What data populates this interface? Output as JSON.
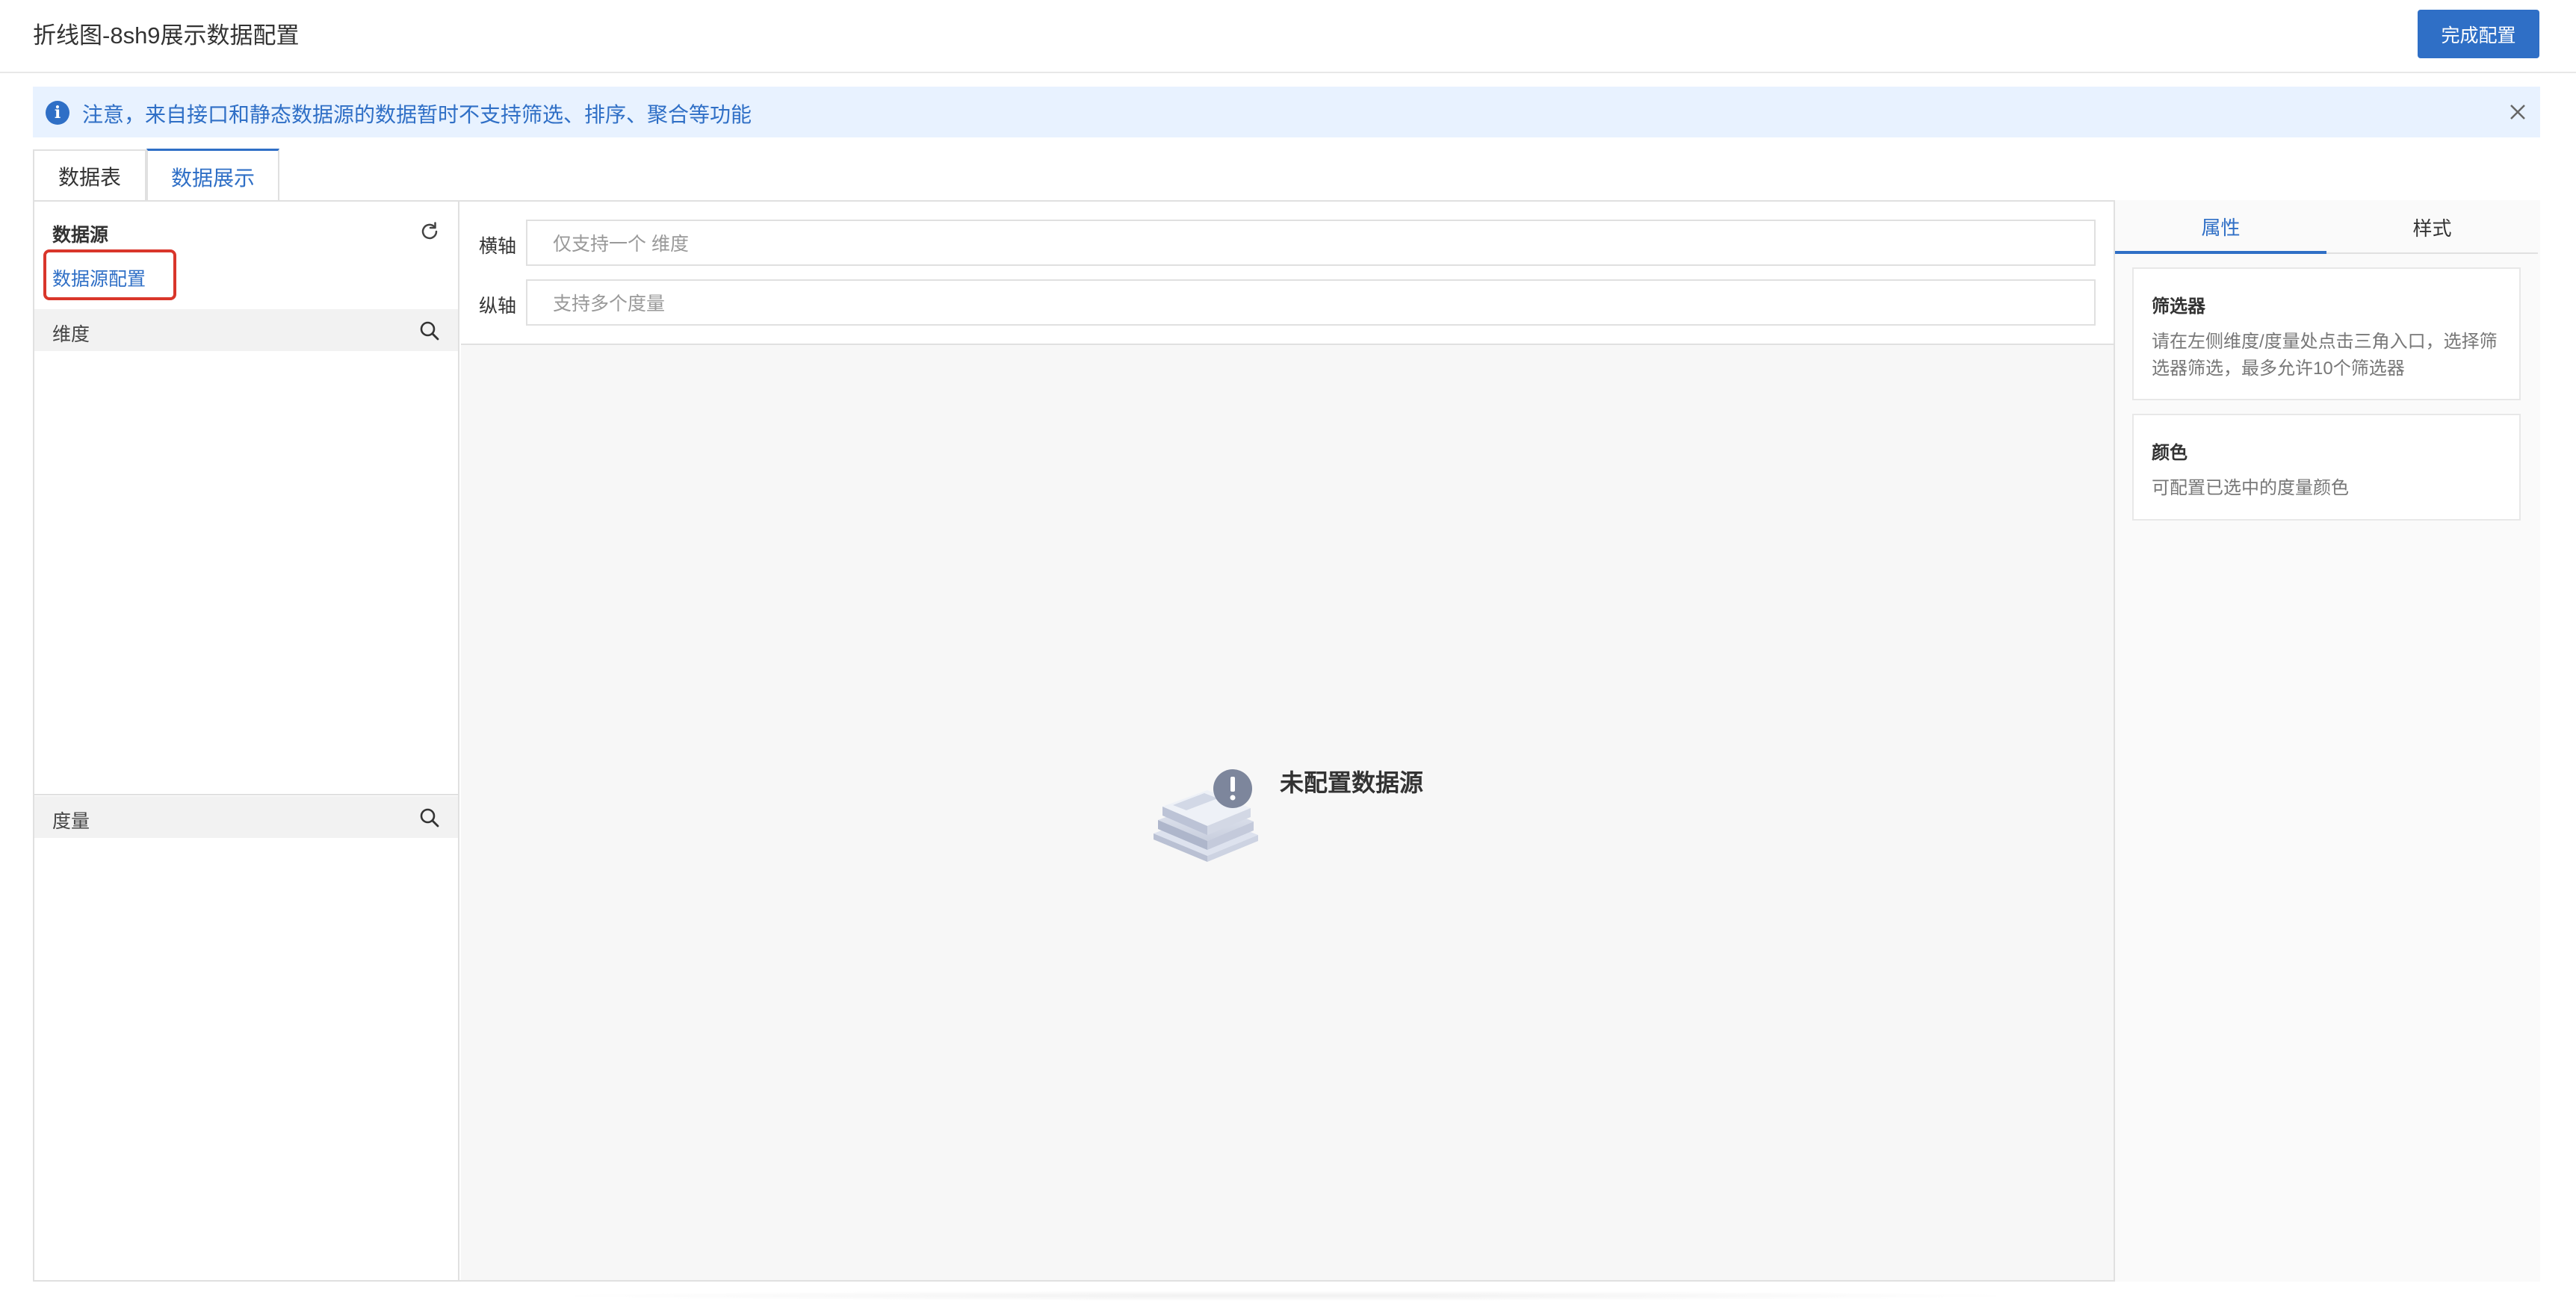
{
  "header": {
    "title": "折线图-8sh9展示数据配置",
    "finish_label": "完成配置"
  },
  "notice": {
    "text": "注意，来自接口和静态数据源的数据暂时不支持筛选、排序、聚合等功能",
    "icon": "info-icon",
    "close_icon": "close-icon"
  },
  "tabs": [
    {
      "label": "数据表",
      "active": false
    },
    {
      "label": "数据展示",
      "active": true
    }
  ],
  "left_panel": {
    "datasource_title": "数据源",
    "datasource_link": "数据源配置",
    "dimension_label": "维度",
    "measure_label": "度量",
    "refresh_icon": "refresh-icon",
    "search_icon": "search-icon"
  },
  "center": {
    "x_axis_label": "横轴",
    "x_axis_placeholder": "仅支持一个 维度",
    "y_axis_label": "纵轴",
    "y_axis_placeholder": "支持多个度量",
    "empty_text": "未配置数据源"
  },
  "right_panel": {
    "tabs": [
      {
        "label": "属性",
        "active": true
      },
      {
        "label": "样式",
        "active": false
      }
    ],
    "filter_title": "筛选器",
    "filter_desc": "请在左侧维度/度量处点击三角入口，选择筛选器筛选，最多允许10个筛选器",
    "color_title": "颜色",
    "color_desc": "可配置已选中的度量颜色"
  },
  "colors": {
    "primary": "#2f6fc6",
    "notice_bg": "#e8f2ff",
    "highlight": "#d9362b"
  }
}
